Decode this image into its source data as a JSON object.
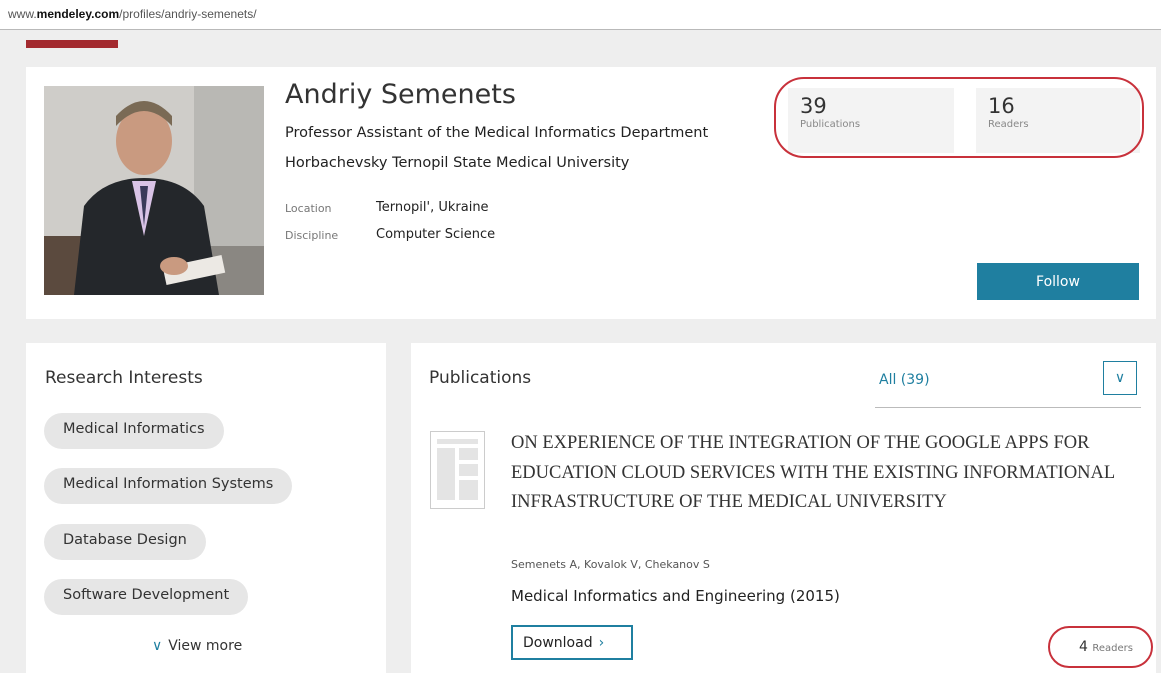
{
  "url": {
    "prefix": "www.",
    "domain": "mendeley.com",
    "path": "/profiles/andriy-semenets/"
  },
  "profile": {
    "name": "Andriy Semenets",
    "role": "Professor Assistant of the Medical Informatics Department",
    "university": "Horbachevsky Ternopil State Medical University",
    "location_label": "Location",
    "location_value": "Ternopil', Ukraine",
    "discipline_label": "Discipline",
    "discipline_value": "Computer Science",
    "stats": [
      {
        "value": "39",
        "label": "Publications"
      },
      {
        "value": "16",
        "label": "Readers"
      }
    ],
    "follow_label": "Follow"
  },
  "interests": {
    "title": "Research Interests",
    "tags": [
      "Medical Informatics",
      "Medical Information Systems",
      "Database Design",
      "Software Development"
    ],
    "view_more": "View more"
  },
  "publications": {
    "title": "Publications",
    "filter_label": "All (39)",
    "items": [
      {
        "title": "On experience of the integration of the Google Apps for Education cloud services with the existing informational infrastructure of the Medical University",
        "authors": "Semenets A, Kovalok V, Chekanov S",
        "journal": "Medical Informatics and Engineering (2015)",
        "download_label": "Download",
        "readers_count": "4",
        "readers_label": "Readers"
      }
    ]
  },
  "colors": {
    "accent": "#1f7fa0",
    "highlight_oval": "#c8313b",
    "brand_red": "#a32a2f"
  }
}
